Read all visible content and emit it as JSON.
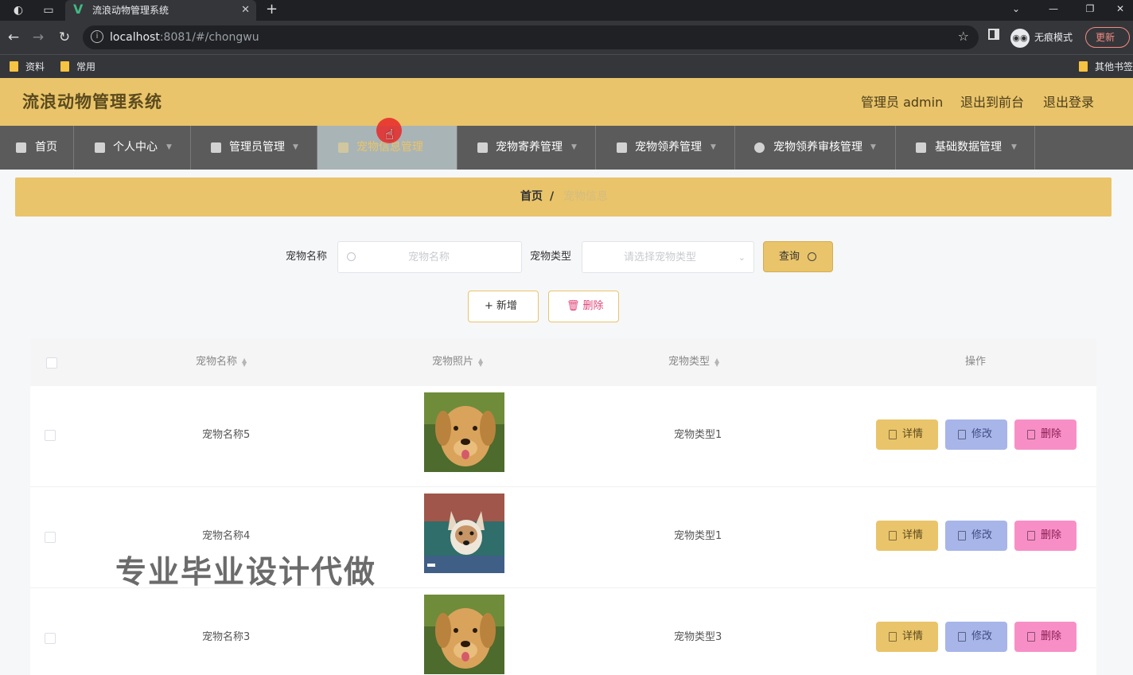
{
  "browser": {
    "tab_title": "流浪动物管理系统",
    "url_host": "localhost",
    "url_path": ":8081/#/chongwu",
    "incognito_label": "无痕模式",
    "update_label": "更新",
    "bookmarks": [
      "资料",
      "常用",
      "其他书签"
    ]
  },
  "header": {
    "title": "流浪动物管理系统",
    "user_label": "管理员 admin",
    "exit_front": "退出到前台",
    "logout": "退出登录"
  },
  "menu": [
    {
      "label": "首页"
    },
    {
      "label": "个人中心"
    },
    {
      "label": "管理员管理"
    },
    {
      "label": "宠物信息管理"
    },
    {
      "label": "宠物寄养管理"
    },
    {
      "label": "宠物领养管理"
    },
    {
      "label": "宠物领养审核管理"
    },
    {
      "label": "基础数据管理"
    }
  ],
  "breadcrumb": {
    "home": "首页",
    "separator": "/",
    "current": "宠物信息"
  },
  "search": {
    "name_label": "宠物名称",
    "name_placeholder": "宠物名称",
    "type_label": "宠物类型",
    "type_placeholder": "请选择宠物类型",
    "query_label": "查询"
  },
  "toolbar": {
    "add_label": "新增",
    "delete_label": "删除"
  },
  "table": {
    "columns": [
      "宠物名称",
      "宠物照片",
      "宠物类型",
      "操作"
    ],
    "rows": [
      {
        "name": "宠物名称5",
        "type": "宠物类型1"
      },
      {
        "name": "宠物名称4",
        "type": "宠物类型1"
      },
      {
        "name": "宠物名称3",
        "type": "宠物类型3"
      }
    ],
    "actions": {
      "detail": "详情",
      "edit": "修改",
      "delete": "删除"
    }
  },
  "watermark": "专业毕业设计代做",
  "colors": {
    "primary": "#e9c46a",
    "menu_bg": "#5b5b5b",
    "edit": "#a7b5e9",
    "delete": "#f78fc6"
  }
}
